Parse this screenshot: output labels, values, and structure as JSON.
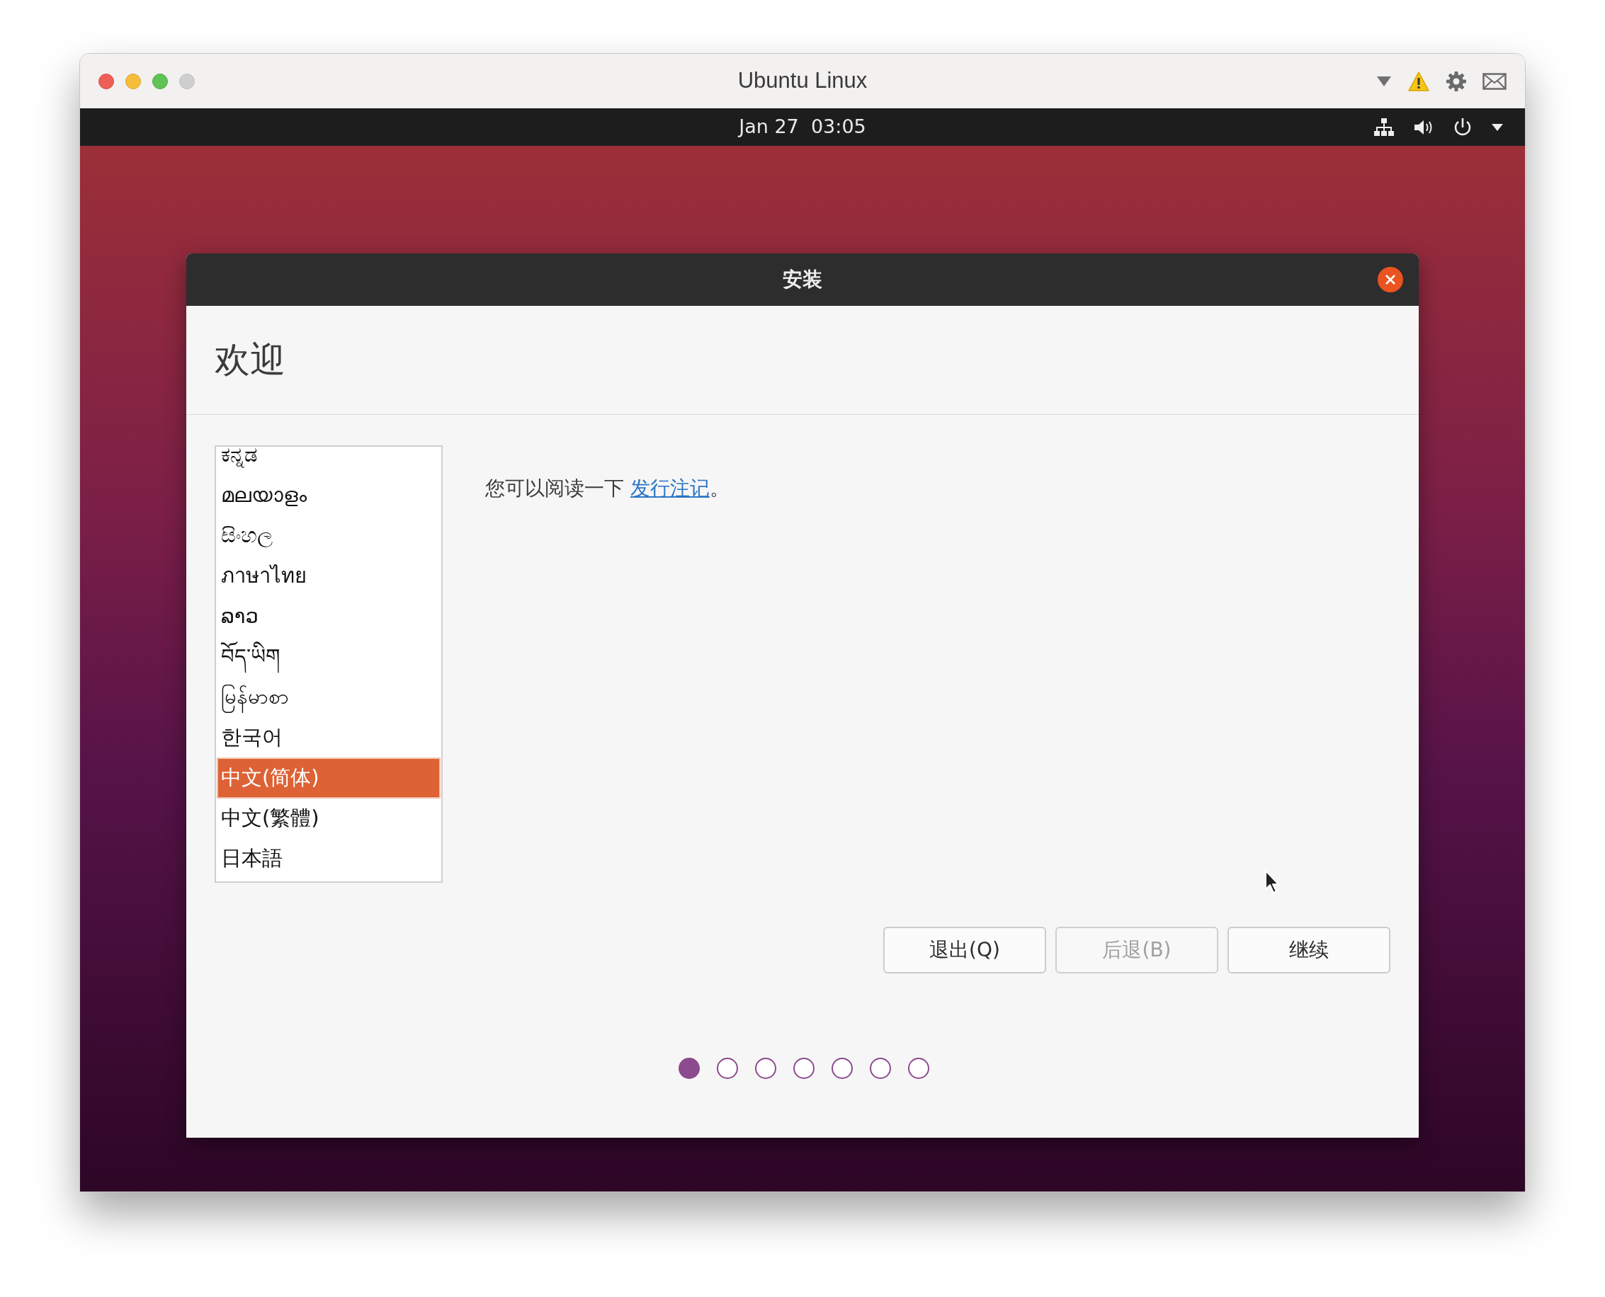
{
  "window": {
    "title": "Ubuntu Linux"
  },
  "top_panel": {
    "clock": "Jan 27  03:05"
  },
  "installer": {
    "title": "安装",
    "heading": "欢迎",
    "languages": [
      {
        "label": "ಕನ್ನಡ",
        "selected": false
      },
      {
        "label": "മലയാളം",
        "selected": false
      },
      {
        "label": "සිංහල",
        "selected": false
      },
      {
        "label": "ภาษาไทย",
        "selected": false
      },
      {
        "label": "ລາວ",
        "selected": false
      },
      {
        "label": "བོད་ཡིག",
        "selected": false
      },
      {
        "label": "မြန်မာစာ",
        "selected": false
      },
      {
        "label": "한국어",
        "selected": false
      },
      {
        "label": "中文(简体)",
        "selected": true
      },
      {
        "label": "中文(繁體)",
        "selected": false
      },
      {
        "label": "日本語",
        "selected": false
      }
    ],
    "release_notes": {
      "text": "您可以阅读一下 ",
      "link": "发行注记",
      "end": "。"
    },
    "buttons": [
      {
        "label": "退出(Q)",
        "disabled": false
      },
      {
        "label": "后退(B)",
        "disabled": true
      },
      {
        "label": "继续",
        "disabled": false
      }
    ],
    "steps": [
      {
        "selected": true
      },
      {
        "selected": false
      },
      {
        "selected": false
      },
      {
        "selected": false
      },
      {
        "selected": false
      },
      {
        "selected": false
      },
      {
        "selected": false
      }
    ]
  }
}
